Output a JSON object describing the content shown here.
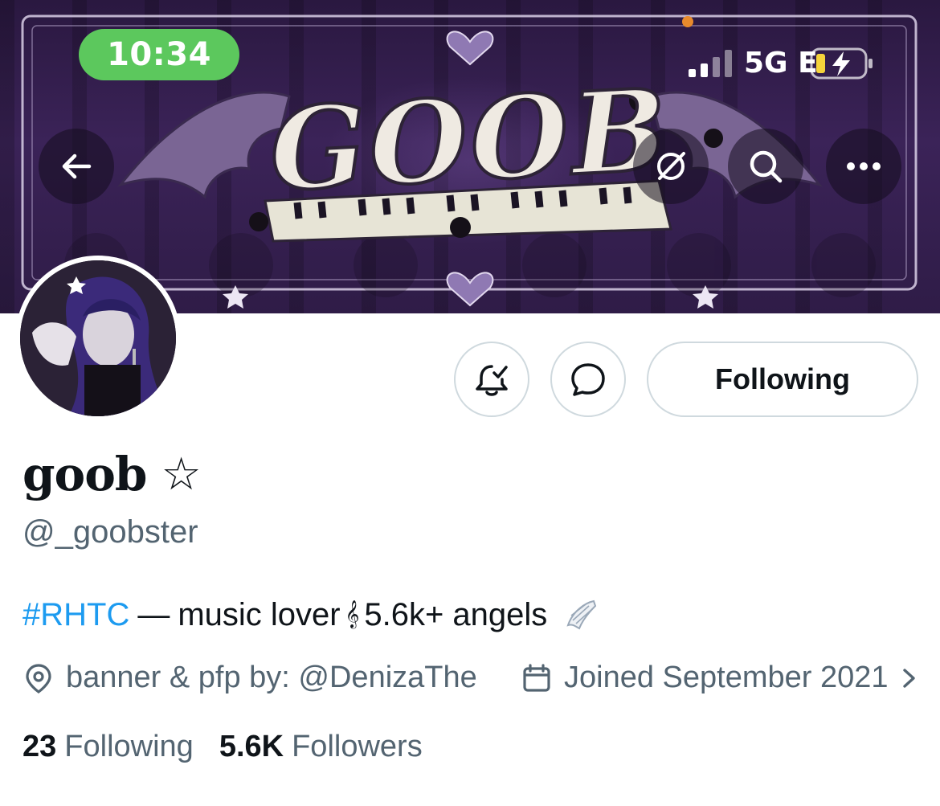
{
  "status_bar": {
    "time": "10:34",
    "network": "5G E"
  },
  "banner": {
    "wordmark": "GOOB"
  },
  "header_icons": [
    "back-arrow-icon",
    "grok-icon",
    "search-icon",
    "more-icon"
  ],
  "actions": {
    "notify_icon": "bell-check-icon",
    "message_icon": "message-bubble-icon",
    "follow_label": "Following"
  },
  "profile": {
    "display_name": "goob",
    "name_symbol": "☆",
    "handle": "@_goobster",
    "bio": {
      "hashtag": "#RHTC",
      "dash": "—",
      "text1": "music lover",
      "clef": "𝄞",
      "text2": "5.6k+ angels"
    },
    "location": "banner & pfp by: @DenizaThe",
    "joined": "Joined September 2021"
  },
  "stats": {
    "following_count": "23",
    "following_label": "Following",
    "followers_count": "5.6K",
    "followers_label": "Followers"
  },
  "colors": {
    "link": "#1d9bf0",
    "secondary_text": "#536471",
    "time_pill": "#5cc85d",
    "banner_base": "#2f1c47"
  }
}
